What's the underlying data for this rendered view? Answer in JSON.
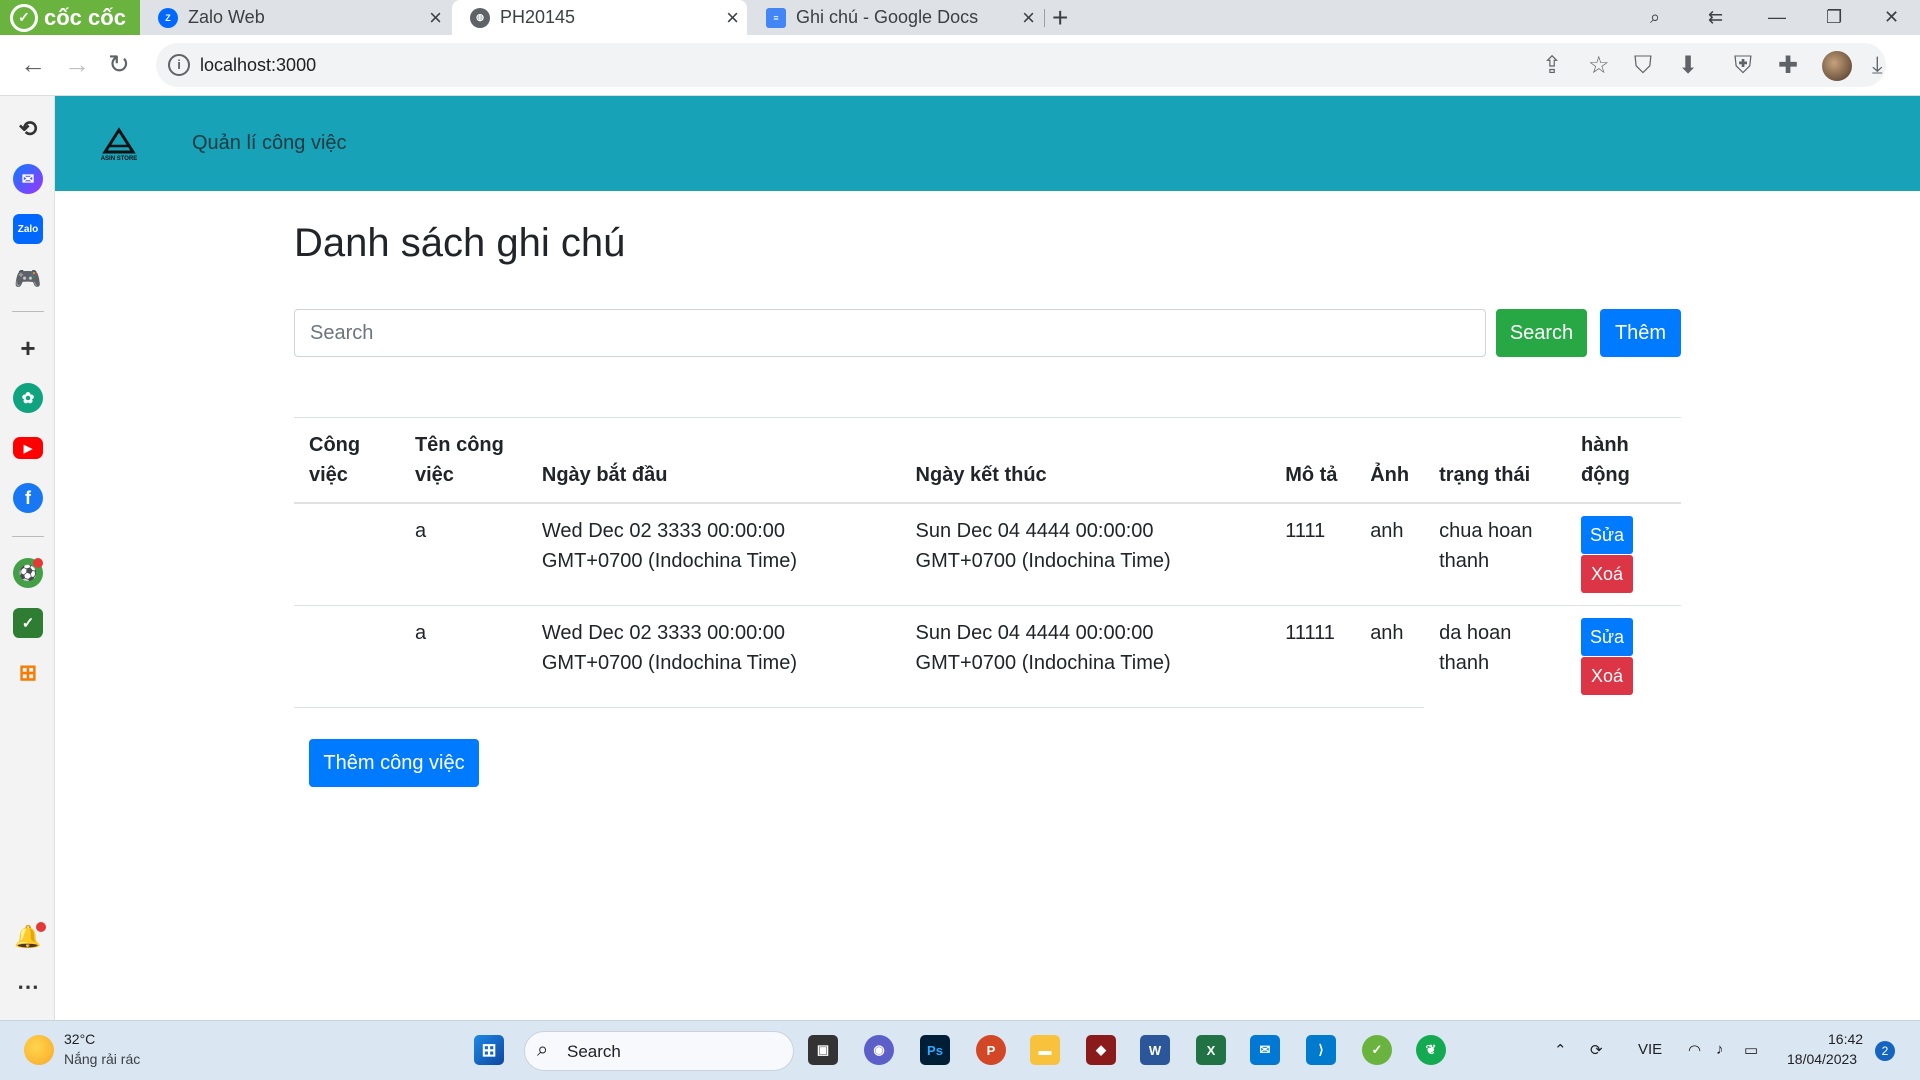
{
  "browser": {
    "brand": "cốc cốc",
    "tabs": [
      {
        "title": "Zalo Web",
        "icon": "zalo-icon"
      },
      {
        "title": "PH20145",
        "icon": "globe-icon"
      },
      {
        "title": "Ghi chú - Google Docs",
        "icon": "google-docs-icon"
      }
    ],
    "url": "localhost:3000"
  },
  "app": {
    "nav_link": "Quản lí công việc",
    "logo_text": "ASIN STORE",
    "title": "Danh sách ghi chú",
    "search_placeholder": "Search",
    "search_button": "Search",
    "add_button": "Thêm",
    "add_task_button": "Thêm công việc",
    "columns": [
      "Công việc",
      "Tên công việc",
      "Ngày bắt đầu",
      "Ngày kết thúc",
      "Mô tả",
      "Ảnh",
      "trạng thái",
      "hành động"
    ],
    "rows": [
      {
        "task": "",
        "name": "a",
        "start": "Wed Dec 02 3333 00:00:00 GMT+0700 (Indochina Time)",
        "end": "Sun Dec 04 4444 00:00:00 GMT+0700 (Indochina Time)",
        "desc": "1111",
        "image": "anh",
        "status": "chua hoan thanh",
        "edit": "Sửa",
        "delete": "Xoá"
      },
      {
        "task": "",
        "name": "a",
        "start": "Wed Dec 02 3333 00:00:00 GMT+0700 (Indochina Time)",
        "end": "Sun Dec 04 4444 00:00:00 GMT+0700 (Indochina Time)",
        "desc": "11111",
        "image": "anh",
        "status": "da hoan thanh",
        "edit": "Sửa",
        "delete": "Xoá"
      }
    ],
    "colors": {
      "navbar": "#17a2b8",
      "success": "#28a745",
      "primary": "#007bff",
      "danger": "#dc3545"
    }
  },
  "taskbar": {
    "weather_temp": "32°C",
    "weather_desc": "Nắng rải rác",
    "search_label": "Search",
    "language": "VIE",
    "time": "16:42",
    "date": "18/04/2023",
    "notification_count": "2"
  }
}
